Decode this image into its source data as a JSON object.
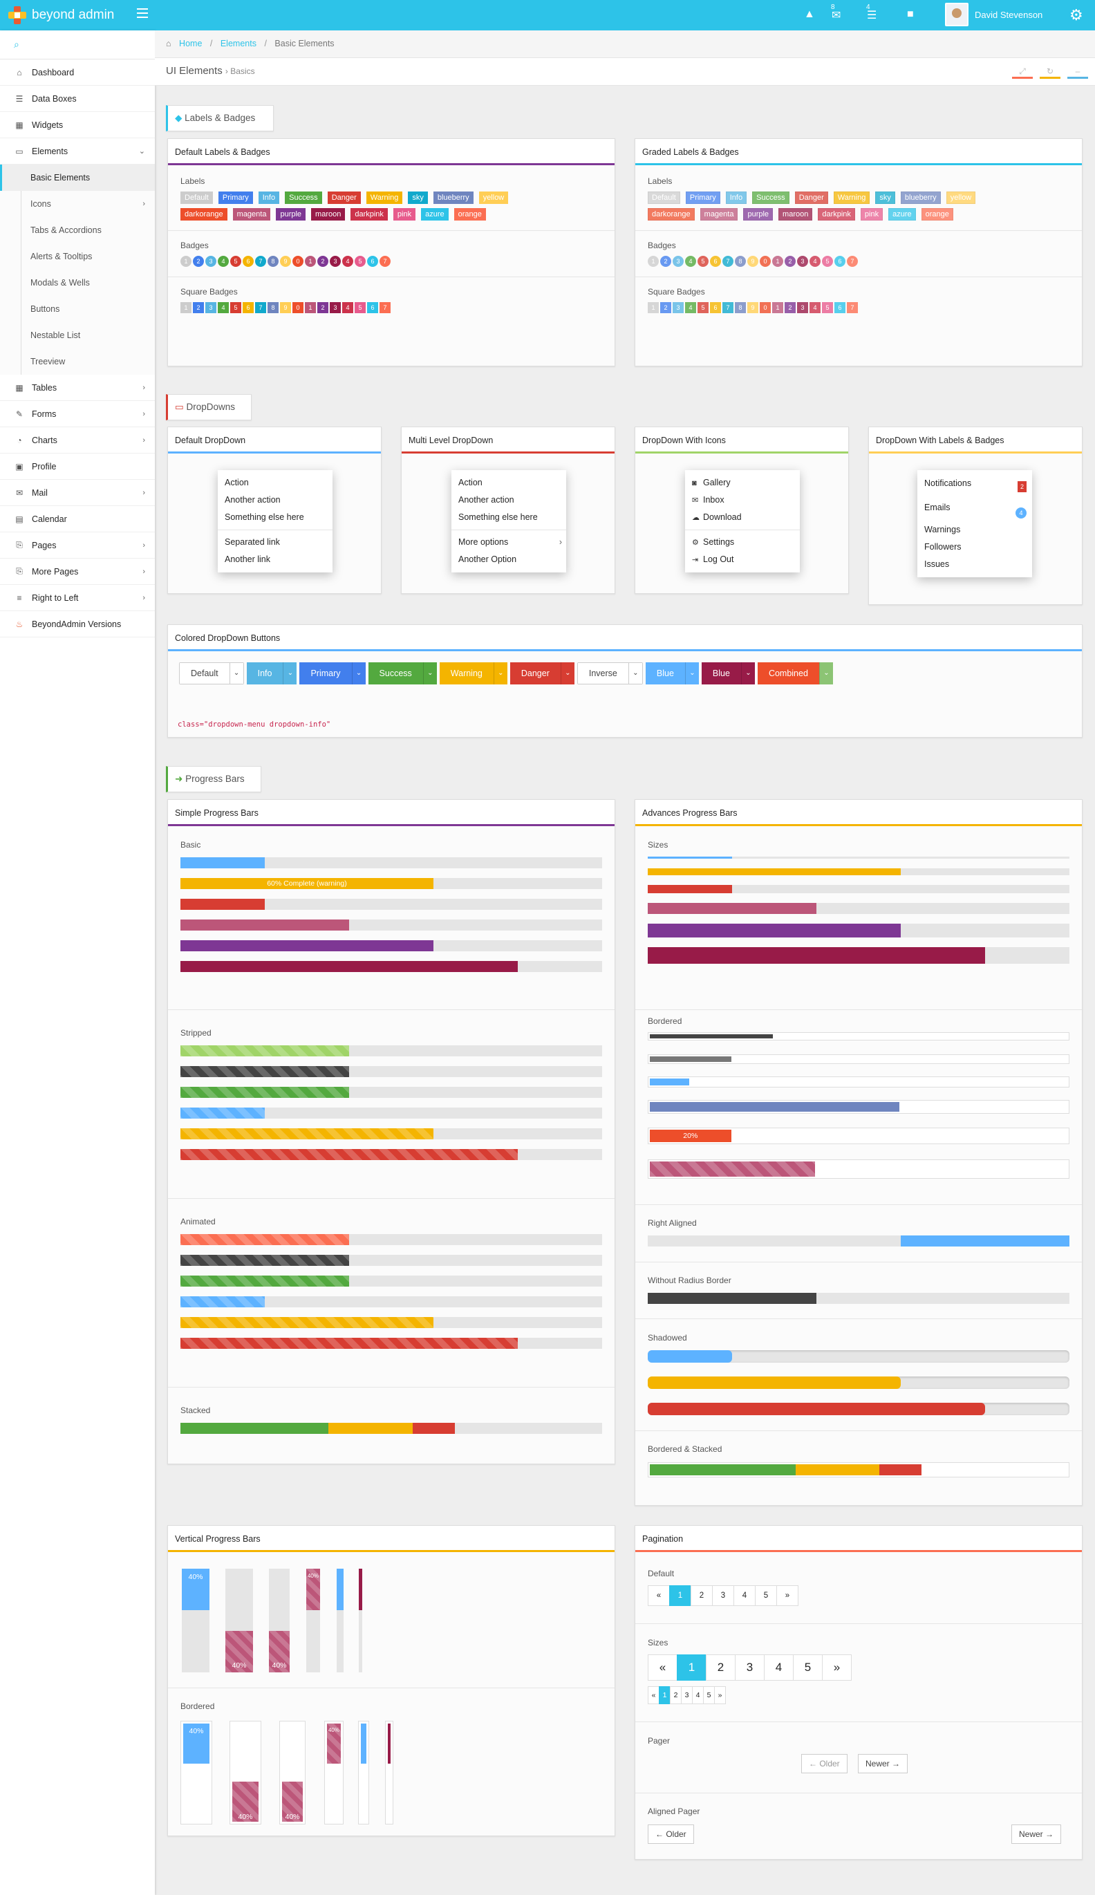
{
  "app": {
    "name": "beyond admin",
    "user": "David Stevenson",
    "notif_a": "8",
    "notif_b": "4"
  },
  "sidebar": {
    "items": [
      {
        "label": "Dashboard",
        "icon": "home-icon",
        "glyph": "⌂"
      },
      {
        "label": "Data Boxes",
        "icon": "boxes-icon",
        "glyph": "☰"
      },
      {
        "label": "Widgets",
        "icon": "grid-icon",
        "glyph": "▦"
      },
      {
        "label": "Elements",
        "icon": "desktop-icon",
        "glyph": "▭"
      }
    ],
    "subitems": [
      "Basic Elements",
      "Icons",
      "Tabs & Accordions",
      "Alerts & Tooltips",
      "Modals & Wells",
      "Buttons",
      "Nestable List",
      "Treeview"
    ],
    "items2": [
      {
        "label": "Tables",
        "glyph": "▦"
      },
      {
        "label": "Forms",
        "glyph": "✎"
      },
      {
        "label": "Charts",
        "glyph": "◔"
      },
      {
        "label": "Profile",
        "glyph": "▣"
      },
      {
        "label": "Mail",
        "glyph": "✉"
      },
      {
        "label": "Calendar",
        "glyph": "▤"
      },
      {
        "label": "Pages",
        "glyph": "⎘"
      },
      {
        "label": "More Pages",
        "glyph": "⎘"
      },
      {
        "label": "Right to Left",
        "glyph": "≡"
      },
      {
        "label": "BeyondAdmin Versions",
        "glyph": "♨"
      }
    ]
  },
  "breadcrumb": {
    "home": "Home",
    "elements": "Elements",
    "current": "Basic Elements"
  },
  "page": {
    "title": "UI Elements",
    "subtitle": "Basics"
  },
  "sections": {
    "labels": "Labels & Badges",
    "dropdowns": "DropDowns",
    "progress": "Progress Bars"
  },
  "labels_widget": {
    "title_default": "Default Labels & Badges",
    "title_graded": "Graded Labels & Badges",
    "labels_heading": "Labels",
    "badges_heading": "Badges",
    "square_heading": "Square Badges",
    "row1": [
      "Default",
      "Primary",
      "Info",
      "Success",
      "Danger",
      "Warning",
      "sky",
      "blueberry",
      "yellow"
    ],
    "row2": [
      "darkorange",
      "magenta",
      "purple",
      "maroon",
      "darkpink",
      "pink",
      "azure",
      "orange"
    ],
    "badges": [
      "1",
      "2",
      "3",
      "4",
      "5",
      "6",
      "7",
      "8",
      "9",
      "0",
      "1",
      "2",
      "3",
      "4",
      "5",
      "6",
      "7"
    ],
    "colors": {
      "Default": "#cccccc",
      "Primary": "#427fed",
      "Info": "#57b5e3",
      "Success": "#53a93f",
      "Danger": "#d73d32",
      "Warning": "#f4b400",
      "sky": "#11a9cc",
      "blueberry": "#6f85bf",
      "yellow": "#ffce55",
      "darkorange": "#ed4e2a",
      "magenta": "#bc5679",
      "purple": "#7e3794",
      "maroon": "#981b48",
      "darkpink": "#cc324b",
      "pink": "#e75b8d",
      "azure": "#2dc3e8",
      "orange": "#fb6e52"
    },
    "badge_colors": [
      "#cccccc",
      "#427fed",
      "#57b5e3",
      "#53a93f",
      "#d73d32",
      "#f4b400",
      "#11a9cc",
      "#6f85bf",
      "#ffce55",
      "#ed4e2a",
      "#bc5679",
      "#7e3794",
      "#981b48",
      "#cc324b",
      "#e75b8d",
      "#2dc3e8",
      "#fb6e52"
    ]
  },
  "dropdowns": {
    "default": {
      "title": "Default DropDown",
      "items": [
        "Action",
        "Another action",
        "Something else here",
        "Separated link",
        "Another link"
      ]
    },
    "multi": {
      "title": "Multi Level DropDown",
      "items": [
        "Action",
        "Another action",
        "Something else here",
        "More options",
        "Another Option"
      ]
    },
    "icons": {
      "title": "DropDown With Icons",
      "items": [
        "Gallery",
        "Inbox",
        "Download",
        "Settings",
        "Log Out"
      ],
      "icon_names": [
        "camera-icon",
        "envelope-icon",
        "cloud-download-icon",
        "cog-icon",
        "sign-out-icon"
      ],
      "glyphs": [
        "◙",
        "✉",
        "☁",
        "⚙",
        "⇥"
      ]
    },
    "badges": {
      "title": "DropDown With Labels & Badges",
      "items": [
        "Notifications",
        "Emails",
        "Warnings",
        "Followers",
        "Issues"
      ],
      "notif_count": "2",
      "email_count": "4"
    },
    "colored": {
      "title": "Colored DropDown Buttons",
      "buttons": [
        "Default",
        "Info",
        "Primary",
        "Success",
        "Warning",
        "Danger",
        "Inverse",
        "Blue",
        "Blue",
        "Combined"
      ],
      "colors": [
        "#ffffff",
        "#57b5e3",
        "#427fed",
        "#53a93f",
        "#f4b400",
        "#d73d32",
        "#ffffff",
        "#5db2ff",
        "#981b48",
        "#ed4e2a"
      ],
      "code": "class=\"dropdown-menu dropdown-info\""
    }
  },
  "progress": {
    "simple": {
      "title": "Simple Progress Bars",
      "basic": "Basic",
      "striped": "Stripped",
      "animated": "Animated",
      "stacked": "Stacked",
      "warning_text": "60% Complete (warning)",
      "basic_values": [
        0.2,
        0.6,
        0.2,
        0.4,
        0.6,
        0.8
      ],
      "basic_colors": [
        "#5db2ff",
        "#f4b400",
        "#d73d32",
        "#bc5679",
        "#7e3794",
        "#981b48"
      ],
      "striped_values": [
        0.4,
        0.4,
        0.4,
        0.2,
        0.6,
        0.8
      ],
      "striped_colors": [
        "#a0d468",
        "#444444",
        "#53a93f",
        "#5db2ff",
        "#f4b400",
        "#d73d32"
      ],
      "animated_values": [
        0.4,
        0.4,
        0.4,
        0.2,
        0.6,
        0.8
      ],
      "animated_colors": [
        "#fb6e52",
        "#444444",
        "#53a93f",
        "#5db2ff",
        "#f4b400",
        "#d73d32"
      ],
      "stacked_values": [
        0.35,
        0.2,
        0.1
      ],
      "stacked_colors": [
        "#53a93f",
        "#f4b400",
        "#d73d32"
      ]
    },
    "advanced": {
      "title": "Advances Progress Bars",
      "sizes": "Sizes",
      "bordered": "Bordered",
      "right_aligned": "Right Aligned",
      "no_radius": "Without Radius Border",
      "shadowed": "Shadowed",
      "bordered_stacked": "Bordered & Stacked",
      "bordered_text": "20%",
      "size_values": [
        0.2,
        0.6,
        0.2,
        0.4,
        0.6,
        0.8
      ],
      "size_colors": [
        "#5db2ff",
        "#f4b400",
        "#d73d32",
        "#bc5679",
        "#7e3794",
        "#981b48"
      ],
      "bordered_values": [
        0.3,
        0.2,
        0.1,
        0.6,
        0.2,
        0.4
      ],
      "bordered_colors": [
        "#444444",
        "#777777",
        "#5db2ff",
        "#6f85bf",
        "#ed4e2a",
        "#bc5679"
      ],
      "right_value": 0.4,
      "right_color": "#5db2ff",
      "noradius_value": 0.4,
      "noradius_color": "#444444",
      "shadow_values": [
        0.2,
        0.6,
        0.8
      ],
      "shadow_colors": [
        "#5db2ff",
        "#f4b400",
        "#d73d32"
      ],
      "bstacked_values": [
        0.35,
        0.2,
        0.1
      ]
    },
    "vertical": {
      "title": "Vertical Progress Bars",
      "bordered": "Bordered",
      "label": "40%"
    }
  },
  "pagination": {
    "title": "Pagination",
    "default": "Default",
    "sizes": "Sizes",
    "pager": "Pager",
    "aligned_pager": "Aligned Pager",
    "pages": [
      "«",
      "1",
      "2",
      "3",
      "4",
      "5",
      "»"
    ],
    "older": "← Older",
    "newer": "Newer →"
  }
}
